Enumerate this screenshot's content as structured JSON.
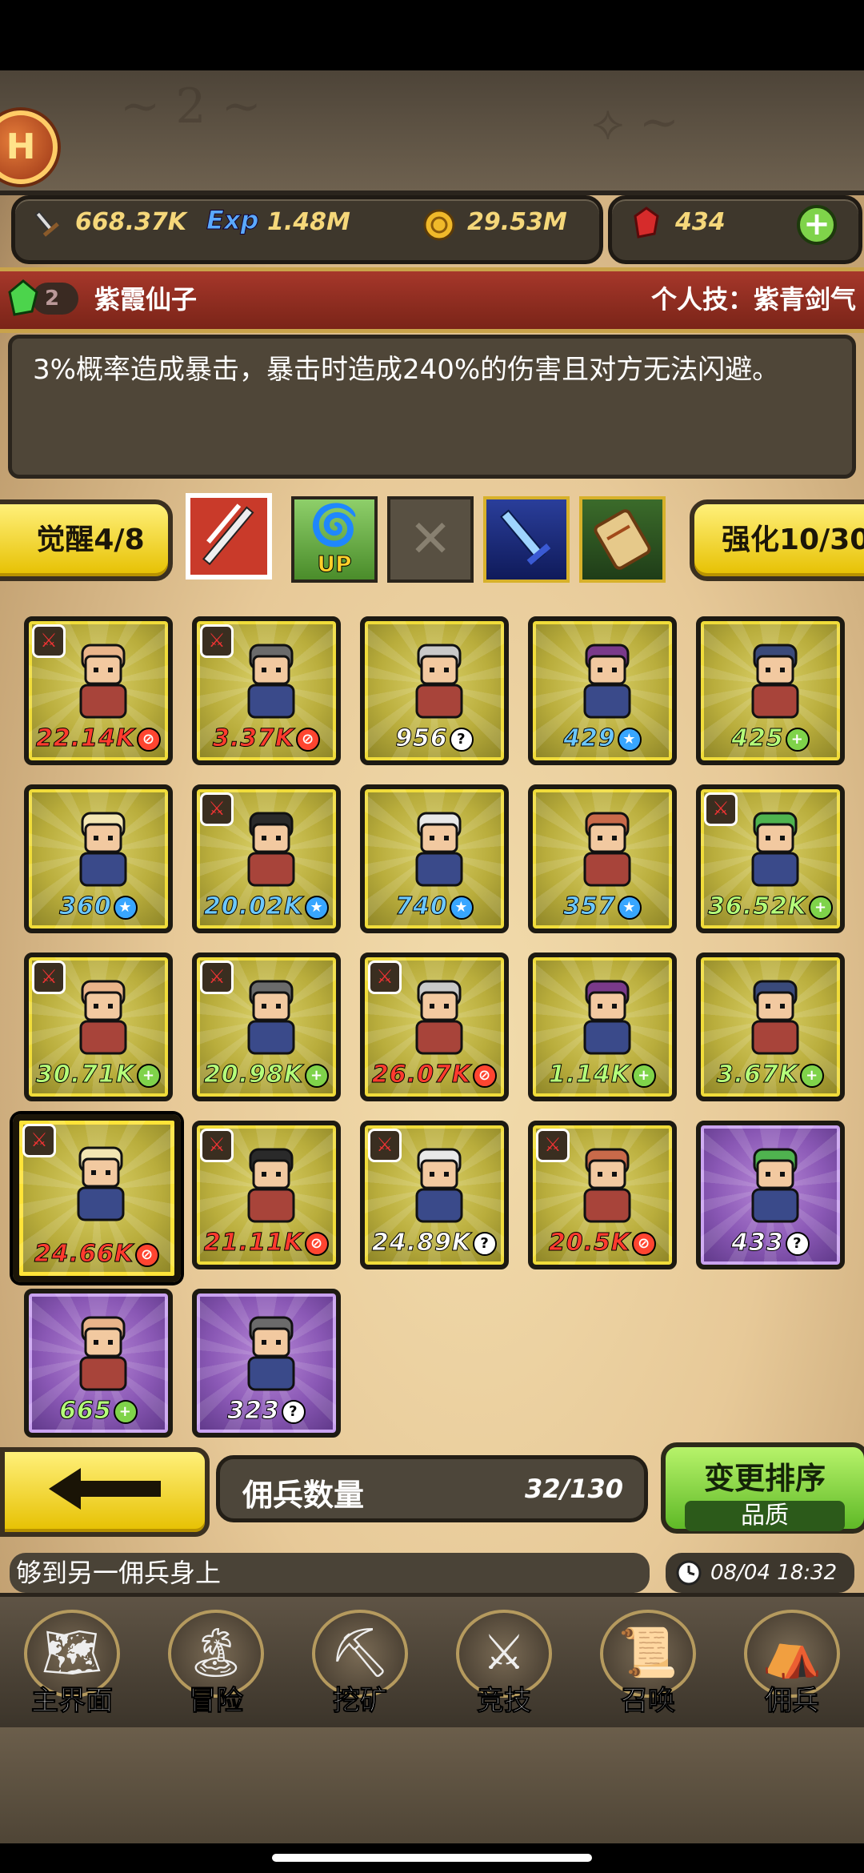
{
  "resources": {
    "attack": "668.37K",
    "exp": "1.48M",
    "gold": "29.53M",
    "gems": "434",
    "exp_icon_text": "Exp"
  },
  "badge_text": "H",
  "hero": {
    "level": "2",
    "name": "紫霞仙子",
    "skill_label": "个人技：紫青剑气",
    "description": "3%概率造成暴击，暴击时造成240%的伤害且对方无法闪避。"
  },
  "buttons": {
    "awaken": "觉醒4/8",
    "enhance": "强化10/30",
    "up_text": "UP"
  },
  "cards": [
    {
      "power": "22.14K",
      "color": "red",
      "role": "red",
      "sword": true,
      "frame": "yellow"
    },
    {
      "power": "3.37K",
      "color": "red",
      "role": "red",
      "sword": true,
      "frame": "yellow"
    },
    {
      "power": "956",
      "color": "white",
      "role": "white",
      "sword": false,
      "frame": "yellow"
    },
    {
      "power": "429",
      "color": "blue",
      "role": "blue",
      "sword": false,
      "frame": "yellow"
    },
    {
      "power": "425",
      "color": "green",
      "role": "green",
      "sword": false,
      "frame": "yellow"
    },
    {
      "power": "360",
      "color": "blue",
      "role": "blue",
      "sword": false,
      "frame": "yellow"
    },
    {
      "power": "20.02K",
      "color": "blue",
      "role": "blue",
      "sword": true,
      "frame": "yellow"
    },
    {
      "power": "740",
      "color": "blue",
      "role": "blue",
      "sword": false,
      "frame": "yellow"
    },
    {
      "power": "357",
      "color": "blue",
      "role": "blue",
      "sword": false,
      "frame": "yellow"
    },
    {
      "power": "36.52K",
      "color": "green",
      "role": "green",
      "sword": true,
      "frame": "yellow"
    },
    {
      "power": "30.71K",
      "color": "green",
      "role": "green",
      "sword": true,
      "frame": "yellow"
    },
    {
      "power": "20.98K",
      "color": "green",
      "role": "green",
      "sword": true,
      "frame": "yellow"
    },
    {
      "power": "26.07K",
      "color": "red",
      "role": "red",
      "sword": true,
      "frame": "yellow"
    },
    {
      "power": "1.14K",
      "color": "green",
      "role": "green",
      "sword": false,
      "frame": "yellow"
    },
    {
      "power": "3.67K",
      "color": "green",
      "role": "green",
      "sword": false,
      "frame": "yellow"
    },
    {
      "power": "24.66K",
      "color": "red",
      "role": "red",
      "sword": true,
      "frame": "yellow",
      "selected": true
    },
    {
      "power": "21.11K",
      "color": "red",
      "role": "red",
      "sword": true,
      "frame": "yellow"
    },
    {
      "power": "24.89K",
      "color": "white",
      "role": "white",
      "sword": true,
      "frame": "yellow"
    },
    {
      "power": "20.5K",
      "color": "red",
      "role": "red",
      "sword": true,
      "frame": "yellow"
    },
    {
      "power": "433",
      "color": "white",
      "role": "white",
      "sword": false,
      "frame": "purple"
    },
    {
      "power": "665",
      "color": "green",
      "role": "green",
      "sword": false,
      "frame": "purple"
    },
    {
      "power": "323",
      "color": "white",
      "role": "white",
      "sword": false,
      "frame": "purple"
    }
  ],
  "mercenary_count": {
    "label": "佣兵数量",
    "value": "32/130"
  },
  "sort": {
    "label": "变更排序",
    "mode": "品质"
  },
  "message": "够到另一佣兵身上",
  "datetime": "08/04 18:32",
  "nav": [
    {
      "label": "主界面",
      "icon": "map-scroll-icon"
    },
    {
      "label": "冒险",
      "icon": "island-icon"
    },
    {
      "label": "挖矿",
      "icon": "pickaxe-icon"
    },
    {
      "label": "竞技",
      "icon": "crossed-swords-icon"
    },
    {
      "label": "召唤",
      "icon": "summon-scroll-icon"
    },
    {
      "label": "佣兵",
      "icon": "tent-icon"
    }
  ],
  "colors": {
    "accent_yellow": "#f5d400",
    "accent_green": "#7fd34a",
    "name_bar_red": "#9a2e22"
  }
}
